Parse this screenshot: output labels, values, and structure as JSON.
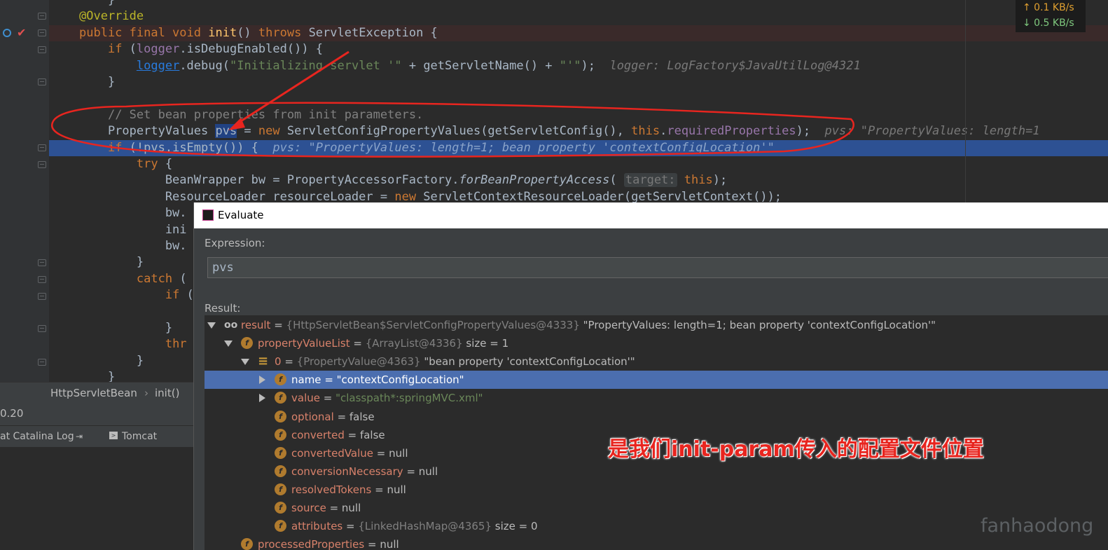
{
  "editor": {
    "lines": [
      {
        "parts": [
          {
            "t": "    ",
            "c": ""
          },
          {
            "t": "}",
            "c": ""
          }
        ]
      },
      {
        "parts": [
          {
            "t": "@Override",
            "c": "ann"
          }
        ]
      },
      {
        "parts": [
          {
            "t": "public final void ",
            "c": "kw"
          },
          {
            "t": "init",
            "c": "fn"
          },
          {
            "t": "() ",
            "c": ""
          },
          {
            "t": "throws ",
            "c": "kw"
          },
          {
            "t": "ServletException {",
            "c": ""
          }
        ]
      },
      {
        "parts": [
          {
            "t": "    ",
            "c": ""
          },
          {
            "t": "if ",
            "c": "kw"
          },
          {
            "t": "(",
            "c": ""
          },
          {
            "t": "logger",
            "c": "fld"
          },
          {
            "t": ".isDebugEnabled()) {",
            "c": ""
          }
        ]
      },
      {
        "parts": [
          {
            "t": "        ",
            "c": ""
          },
          {
            "t": "logger",
            "c": "ul"
          },
          {
            "t": ".debug(",
            "c": ""
          },
          {
            "t": "\"Initializing servlet '\"",
            "c": "str"
          },
          {
            "t": " + getServletName() + ",
            "c": ""
          },
          {
            "t": "\"'\"",
            "c": "str"
          },
          {
            "t": ");  ",
            "c": ""
          },
          {
            "t": "logger: LogFactory$JavaUtilLog@4321",
            "c": "inl"
          }
        ]
      },
      {
        "parts": [
          {
            "t": "    }",
            "c": ""
          }
        ]
      },
      {
        "parts": [
          {
            "t": "",
            "c": ""
          }
        ]
      },
      {
        "parts": [
          {
            "t": "    ",
            "c": ""
          },
          {
            "t": "// Set bean properties from init parameters.",
            "c": "cmt"
          }
        ]
      },
      {
        "parts": [
          {
            "t": "    PropertyValues ",
            "c": ""
          },
          {
            "t": "pvs",
            "c": "sel"
          },
          {
            "t": " = ",
            "c": ""
          },
          {
            "t": "new ",
            "c": "kw"
          },
          {
            "t": "ServletConfigPropertyValues(getServletConfig(), ",
            "c": ""
          },
          {
            "t": "this",
            "c": "kw"
          },
          {
            "t": ".",
            "c": ""
          },
          {
            "t": "requiredProperties",
            "c": "fld"
          },
          {
            "t": ");  ",
            "c": ""
          },
          {
            "t": "pvs: \"PropertyValues: length=1",
            "c": "inl"
          }
        ]
      },
      {
        "parts": [
          {
            "t": "    ",
            "c": ""
          },
          {
            "t": "if ",
            "c": "kw"
          },
          {
            "t": "(!pvs.isEmpty()) {  ",
            "c": ""
          },
          {
            "t": "pvs: \"PropertyValues: length=1; bean property 'contextConfigLocation'\"",
            "c": "curinl"
          }
        ]
      },
      {
        "parts": [
          {
            "t": "        ",
            "c": ""
          },
          {
            "t": "try ",
            "c": "kw"
          },
          {
            "t": "{",
            "c": ""
          }
        ]
      },
      {
        "parts": [
          {
            "t": "            BeanWrapper bw = PropertyAccessorFactory.",
            "c": ""
          },
          {
            "t": "forBeanPropertyAccess",
            "c": "ital"
          },
          {
            "t": "( ",
            "c": ""
          },
          {
            "t": "target:",
            "c": "hint"
          },
          {
            "t": " ",
            "c": ""
          },
          {
            "t": "this",
            "c": "kw"
          },
          {
            "t": ");",
            "c": ""
          }
        ]
      },
      {
        "parts": [
          {
            "t": "            ResourceLoader resourceLoader = ",
            "c": ""
          },
          {
            "t": "new ",
            "c": "kw"
          },
          {
            "t": "ServletContextResourceLoader(getServletContext());",
            "c": ""
          }
        ]
      },
      {
        "parts": [
          {
            "t": "            bw.",
            "c": ""
          }
        ]
      },
      {
        "parts": [
          {
            "t": "            ini",
            "c": ""
          }
        ]
      },
      {
        "parts": [
          {
            "t": "            bw.",
            "c": ""
          }
        ]
      },
      {
        "parts": [
          {
            "t": "        }",
            "c": ""
          }
        ]
      },
      {
        "parts": [
          {
            "t": "        ",
            "c": ""
          },
          {
            "t": "catch ",
            "c": "kw"
          },
          {
            "t": "(",
            "c": ""
          }
        ]
      },
      {
        "parts": [
          {
            "t": "            ",
            "c": ""
          },
          {
            "t": "if ",
            "c": "kw"
          },
          {
            "t": "(",
            "c": ""
          }
        ]
      },
      {
        "parts": [
          {
            "t": "",
            "c": ""
          }
        ]
      },
      {
        "parts": [
          {
            "t": "            }",
            "c": ""
          }
        ]
      },
      {
        "parts": [
          {
            "t": "            ",
            "c": ""
          },
          {
            "t": "thr",
            "c": "kw"
          }
        ]
      },
      {
        "parts": [
          {
            "t": "        }",
            "c": ""
          }
        ]
      },
      {
        "parts": [
          {
            "t": "    }",
            "c": ""
          }
        ]
      }
    ]
  },
  "network": {
    "up": "↑ 0.1 KB/s",
    "down": "↓ 0.5 KB/s"
  },
  "breadcrumb": {
    "class_name": "HttpServletBean",
    "method": "init()"
  },
  "left_panel": {
    "version": "0.20",
    "tab1": "at Catalina Log",
    "tab2": "Tomcat Localho"
  },
  "dialog": {
    "title": "Evaluate",
    "expression_label": "Expression:",
    "expression_value": "pvs",
    "result_label": "Result:",
    "rows": [
      {
        "name": "result",
        "ref": "{HttpServletBean$ServletConfigPropertyValues@4333}",
        "val": " \"PropertyValues: length=1; bean property 'contextConfigLocation'\"",
        "icon": "watch",
        "arrow": "down",
        "indent": 0
      },
      {
        "name": "propertyValueList",
        "ref": "{ArrayList@4336}",
        "val": "  size = 1",
        "icon": "field",
        "arrow": "down",
        "indent": 1
      },
      {
        "name": "0",
        "ref": "{PropertyValue@4363}",
        "val": " \"bean property 'contextConfigLocation'\"",
        "icon": "list",
        "arrow": "down",
        "indent": 2
      },
      {
        "name": "name",
        "ref": "",
        "val": "\"contextConfigLocation\"",
        "icon": "field",
        "arrow": "right",
        "indent": 3,
        "selected": true,
        "str": true
      },
      {
        "name": "value",
        "ref": "",
        "val": "\"classpath*:springMVC.xml\"",
        "icon": "field",
        "arrow": "right",
        "indent": 3,
        "str": true
      },
      {
        "name": "optional",
        "ref": "",
        "val": "false",
        "icon": "field",
        "arrow": "",
        "indent": 3
      },
      {
        "name": "converted",
        "ref": "",
        "val": "false",
        "icon": "field",
        "arrow": "",
        "indent": 3
      },
      {
        "name": "convertedValue",
        "ref": "",
        "val": "null",
        "icon": "field",
        "arrow": "",
        "indent": 3
      },
      {
        "name": "conversionNecessary",
        "ref": "",
        "val": "null",
        "icon": "field",
        "arrow": "",
        "indent": 3
      },
      {
        "name": "resolvedTokens",
        "ref": "",
        "val": "null",
        "icon": "field",
        "arrow": "",
        "indent": 3
      },
      {
        "name": "source",
        "ref": "",
        "val": "null",
        "icon": "field",
        "arrow": "",
        "indent": 3
      },
      {
        "name": "attributes",
        "ref": "{LinkedHashMap@4365}",
        "val": "  size = 0",
        "icon": "field",
        "arrow": "",
        "indent": 3
      },
      {
        "name": "processedProperties",
        "ref": "",
        "val": "null",
        "icon": "field",
        "arrow": "",
        "indent": 1
      }
    ]
  },
  "annotation": {
    "note": "是我们init-param传入的配置文件位置",
    "watermark": "fanhaodong"
  },
  "colors": {
    "annotation_red": "#e8251f",
    "selection_blue": "#2d5193",
    "tree_selection": "#4b6eaf"
  }
}
